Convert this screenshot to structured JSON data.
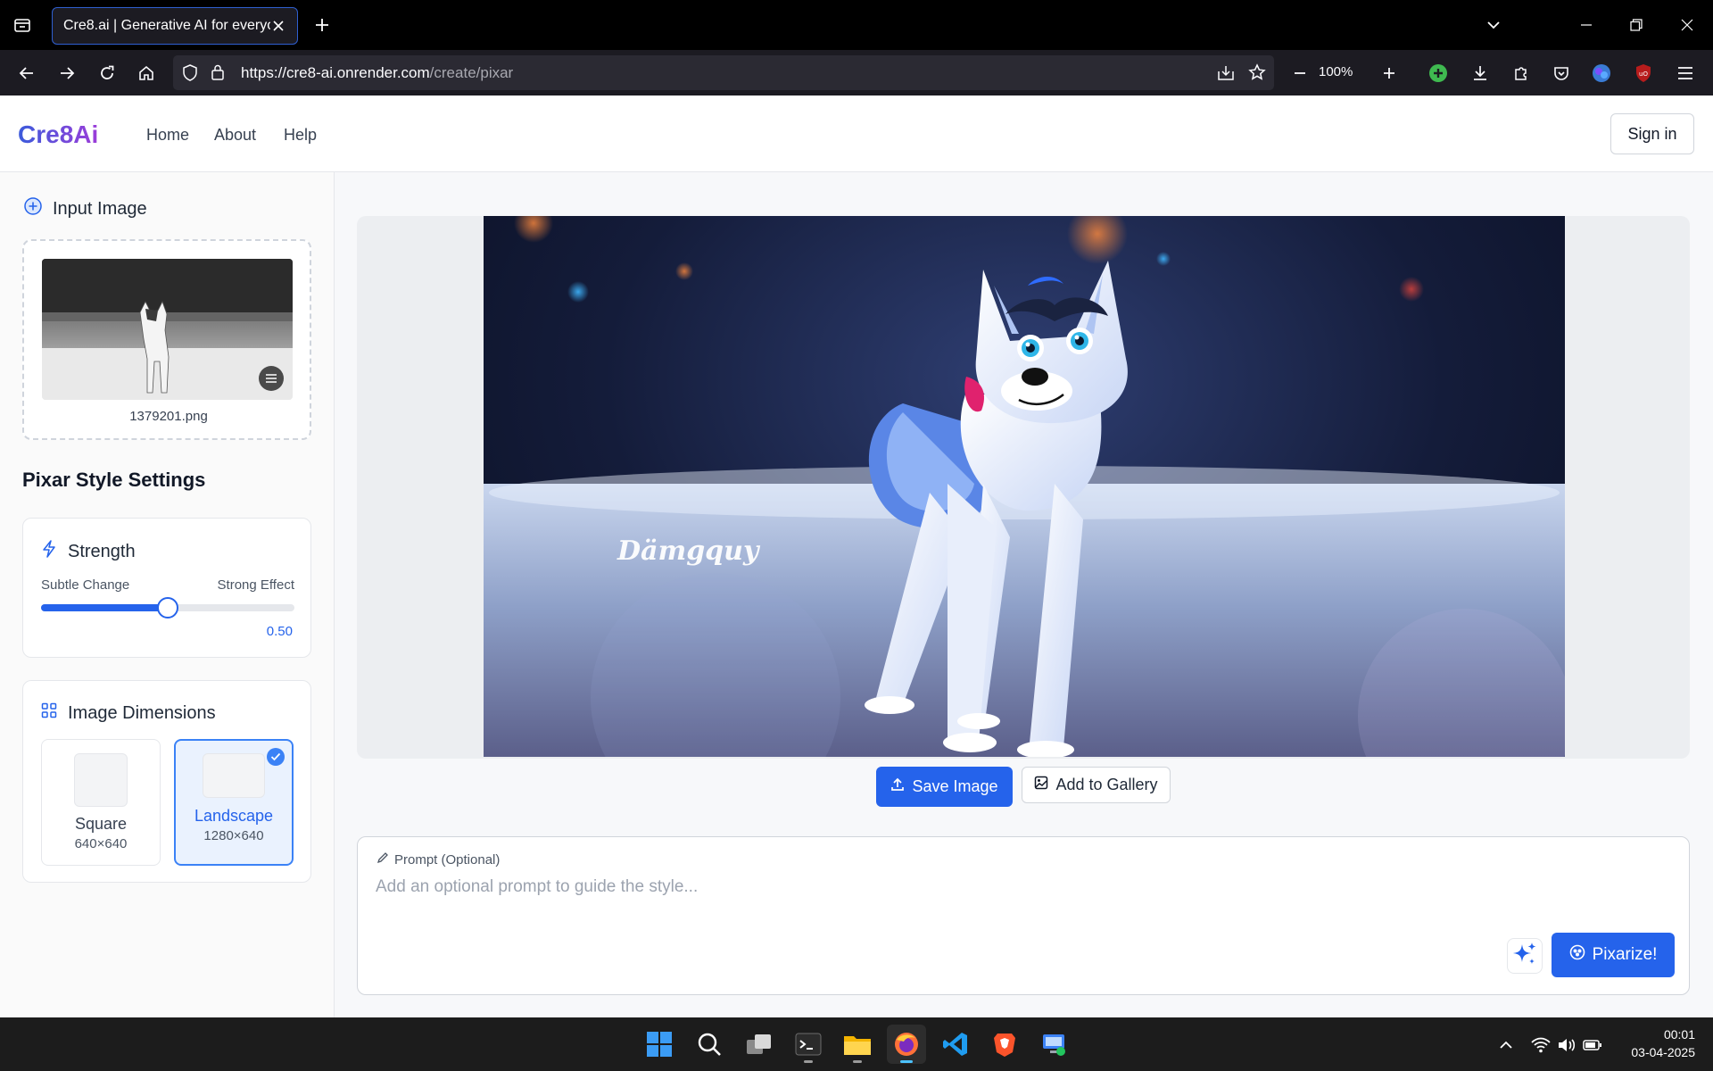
{
  "browser": {
    "tab_title": "Cre8.ai | Generative AI for everyone",
    "url_host": "https://cre8-ai.onrender.com",
    "url_path": "/create/pixar",
    "zoom": "100%"
  },
  "header": {
    "logo": "Cre8Ai",
    "nav": [
      "Home",
      "About",
      "Help"
    ],
    "signin_label": "Sign in"
  },
  "sidebar": {
    "input_title": "Input Image",
    "filename": "1379201.png",
    "settings_title": "Pixar Style Settings",
    "strength": {
      "title": "Strength",
      "min_label": "Subtle Change",
      "max_label": "Strong Effect",
      "value": 0.5,
      "value_label": "0.50"
    },
    "dimensions": {
      "title": "Image Dimensions",
      "options": [
        {
          "label": "Square",
          "size": "640×640",
          "selected": false
        },
        {
          "label": "Landscape",
          "size": "1280×640",
          "selected": true
        }
      ]
    }
  },
  "main": {
    "watermark": "Dämgquy",
    "save_label": "Save Image",
    "gallery_label": "Add to Gallery",
    "prompt_label": "Prompt (Optional)",
    "prompt_placeholder": "Add an optional prompt to guide the style...",
    "pixarize_label": "Pixarize!"
  },
  "taskbar": {
    "apps": [
      "windows-start",
      "search",
      "task-view",
      "terminal",
      "file-explorer",
      "firefox",
      "vs-code",
      "brave",
      "remote-desktop"
    ],
    "time": "00:01",
    "date": "03-04-2025"
  },
  "colors": {
    "accent": "#2563eb",
    "logo_gradient_start": "#3b5bdb",
    "logo_gradient_end": "#9c3dd9"
  }
}
